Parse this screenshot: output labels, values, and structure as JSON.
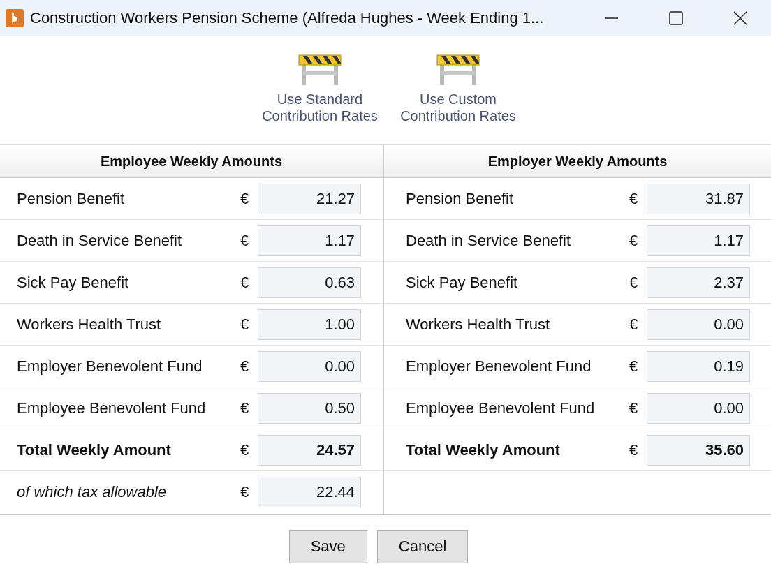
{
  "window": {
    "title": "Construction Workers Pension Scheme (Alfreda Hughes - Week Ending 1..."
  },
  "toolbar": [
    {
      "lines": [
        "Use Standard",
        "Contribution Rates"
      ]
    },
    {
      "lines": [
        "Use Custom",
        "Contribution Rates"
      ]
    }
  ],
  "panels": [
    {
      "heading": "Employee Weekly Amounts",
      "rows": [
        {
          "kind": "item",
          "label": "Pension Benefit",
          "currency": "€",
          "value": "21.27"
        },
        {
          "kind": "item",
          "label": "Death in Service Benefit",
          "currency": "€",
          "value": "1.17"
        },
        {
          "kind": "item",
          "label": "Sick Pay Benefit",
          "currency": "€",
          "value": "0.63"
        },
        {
          "kind": "item",
          "label": "Workers Health Trust",
          "currency": "€",
          "value": "1.00"
        },
        {
          "kind": "item",
          "label": "Employer Benevolent Fund",
          "currency": "€",
          "value": "0.00"
        },
        {
          "kind": "item",
          "label": "Employee Benevolent Fund",
          "currency": "€",
          "value": "0.50"
        },
        {
          "kind": "total",
          "label": "Total Weekly Amount",
          "currency": "€",
          "value": "24.57"
        },
        {
          "kind": "note",
          "label": "of which tax allowable",
          "currency": "€",
          "value": "22.44"
        }
      ]
    },
    {
      "heading": "Employer Weekly Amounts",
      "rows": [
        {
          "kind": "item",
          "label": "Pension Benefit",
          "currency": "€",
          "value": "31.87"
        },
        {
          "kind": "item",
          "label": "Death in Service Benefit",
          "currency": "€",
          "value": "1.17"
        },
        {
          "kind": "item",
          "label": "Sick Pay Benefit",
          "currency": "€",
          "value": "2.37"
        },
        {
          "kind": "item",
          "label": "Workers Health Trust",
          "currency": "€",
          "value": "0.00"
        },
        {
          "kind": "item",
          "label": "Employer Benevolent Fund",
          "currency": "€",
          "value": "0.19"
        },
        {
          "kind": "item",
          "label": "Employee Benevolent Fund",
          "currency": "€",
          "value": "0.00"
        },
        {
          "kind": "total",
          "label": "Total Weekly Amount",
          "currency": "€",
          "value": "35.60"
        }
      ]
    }
  ],
  "buttons": [
    "Save",
    "Cancel"
  ]
}
